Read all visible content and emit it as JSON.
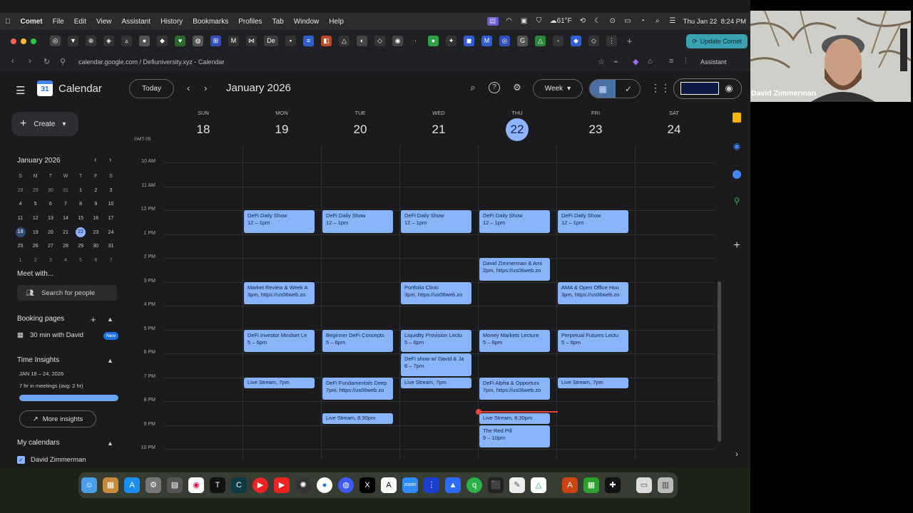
{
  "menubar": {
    "app": "Comet",
    "items": [
      "File",
      "Edit",
      "View",
      "Assistant",
      "History",
      "Bookmarks",
      "Profiles",
      "Tab",
      "Window",
      "Help"
    ],
    "weather": "61°F",
    "datetime": "Thu Jan 22  8:24 PM"
  },
  "browser": {
    "update_label": "Update Comet",
    "url": "calendar.google.com / Defiuniversity.xyz - Calendar",
    "assistant_label": "Assistant"
  },
  "calendar": {
    "app_title": "Calendar",
    "today_label": "Today",
    "month_label": "January 2026",
    "view_label": "Week",
    "timezone": "GMT-05",
    "days": [
      {
        "dow": "SUN",
        "num": "18"
      },
      {
        "dow": "MON",
        "num": "19"
      },
      {
        "dow": "TUE",
        "num": "20"
      },
      {
        "dow": "WED",
        "num": "21"
      },
      {
        "dow": "THU",
        "num": "22",
        "today": true
      },
      {
        "dow": "FRI",
        "num": "23"
      },
      {
        "dow": "SAT",
        "num": "24"
      }
    ],
    "hours": [
      "10 AM",
      "11 AM",
      "12 PM",
      "1 PM",
      "2 PM",
      "3 PM",
      "4 PM",
      "5 PM",
      "6 PM",
      "7 PM",
      "8 PM",
      "9 PM",
      "10 PM"
    ],
    "events": [
      {
        "day": 1,
        "start": 12,
        "end": 13,
        "title": "DeFi Daily Show",
        "sub": "12 – 1pm"
      },
      {
        "day": 2,
        "start": 12,
        "end": 13,
        "title": "DeFi Daily Show",
        "sub": "12 – 1pm"
      },
      {
        "day": 3,
        "start": 12,
        "end": 13,
        "title": "DeFi Daily Show",
        "sub": "12 – 1pm"
      },
      {
        "day": 4,
        "start": 12,
        "end": 13,
        "title": "DeFi Daily Show",
        "sub": "12 – 1pm"
      },
      {
        "day": 5,
        "start": 12,
        "end": 13,
        "title": "DeFi Daily Show",
        "sub": "12 – 1pm"
      },
      {
        "day": 4,
        "start": 14,
        "end": 15,
        "title": "David Zimmerman & Ami",
        "sub": "2pm, https://us06web.zo"
      },
      {
        "day": 1,
        "start": 15,
        "end": 16,
        "title": "Market Review & Week A",
        "sub": "3pm, https://us06web.zo"
      },
      {
        "day": 3,
        "start": 15,
        "end": 16,
        "title": "Portfolio Clinic",
        "sub": "3pm, https://us06web.zo"
      },
      {
        "day": 5,
        "start": 15,
        "end": 16,
        "title": "AMA & Open Office Hou",
        "sub": "3pm, https://us06web.zo"
      },
      {
        "day": 1,
        "start": 17,
        "end": 18,
        "title": "DeFi Investor Mindset Le",
        "sub": "5 – 6pm"
      },
      {
        "day": 2,
        "start": 17,
        "end": 18,
        "title": "Beginner DeFi Concepts",
        "sub": "5 – 6pm"
      },
      {
        "day": 3,
        "start": 17,
        "end": 18,
        "title": "Liquidity Provision Lectu",
        "sub": "5 – 6pm"
      },
      {
        "day": 4,
        "start": 17,
        "end": 18,
        "title": "Money Markets Lecture",
        "sub": "5 – 6pm"
      },
      {
        "day": 5,
        "start": 17,
        "end": 18,
        "title": "Perpetual Futures Lectu",
        "sub": "5 – 6pm"
      },
      {
        "day": 3,
        "start": 18,
        "end": 19,
        "title": "DeFi show w/ David & Ja",
        "sub": "6 – 7pm"
      },
      {
        "day": 1,
        "start": 19,
        "end": 19.5,
        "title": "Live Stream, 7pm",
        "sub": ""
      },
      {
        "day": 2,
        "start": 19,
        "end": 20,
        "title": "DeFi Fundamentals Deep",
        "sub": "7pm, https://us06web.zo"
      },
      {
        "day": 3,
        "start": 19,
        "end": 19.5,
        "title": "Live Stream, 7pm",
        "sub": ""
      },
      {
        "day": 4,
        "start": 19,
        "end": 20,
        "title": "DeFi Alpha & Opportuni",
        "sub": "7pm, https://us06web.zo"
      },
      {
        "day": 5,
        "start": 19,
        "end": 19.5,
        "title": "Live Stream, 7pm",
        "sub": ""
      },
      {
        "day": 2,
        "start": 20.5,
        "end": 21,
        "title": "Live Stream, 8:30pm",
        "sub": ""
      },
      {
        "day": 4,
        "start": 20.5,
        "end": 21,
        "title": "Live Stream, 8:30pm",
        "sub": ""
      },
      {
        "day": 4,
        "start": 21,
        "end": 22,
        "title": "The Red Pill",
        "sub": "9 – 10pm"
      }
    ],
    "now_hour": 20.4
  },
  "sidebar": {
    "create_label": "Create",
    "mini_month": "January 2026",
    "weekdays": [
      "S",
      "M",
      "T",
      "W",
      "T",
      "F",
      "S"
    ],
    "weeks": [
      [
        "28",
        "29",
        "30",
        "31",
        "1",
        "2",
        "3"
      ],
      [
        "4",
        "5",
        "6",
        "7",
        "8",
        "9",
        "10"
      ],
      [
        "11",
        "12",
        "13",
        "14",
        "15",
        "16",
        "17"
      ],
      [
        "18",
        "19",
        "20",
        "21",
        "22",
        "23",
        "24"
      ],
      [
        "25",
        "26",
        "27",
        "28",
        "29",
        "30",
        "31"
      ],
      [
        "1",
        "2",
        "3",
        "4",
        "5",
        "6",
        "7"
      ]
    ],
    "meet_with": "Meet with...",
    "search_people": "Search for people",
    "booking_pages": "Booking pages",
    "booking_item": "30 min with David",
    "new_badge": "New",
    "time_insights": "Time Insights",
    "ti_range": "JAN 18 – 24, 2026",
    "ti_meetings": "7 hr in meetings (avg: 2 hr)",
    "ti_fill": 1.0,
    "more_insights": "More insights",
    "my_calendars": "My calendars",
    "my_cal_item": "David Zimmerman"
  },
  "webcam": {
    "name": "David Zimmerman"
  },
  "colors": {
    "event": "#8ab4f8",
    "today": "#8fb4ff",
    "now": "#ea4335",
    "update": "#3aa3b1"
  }
}
